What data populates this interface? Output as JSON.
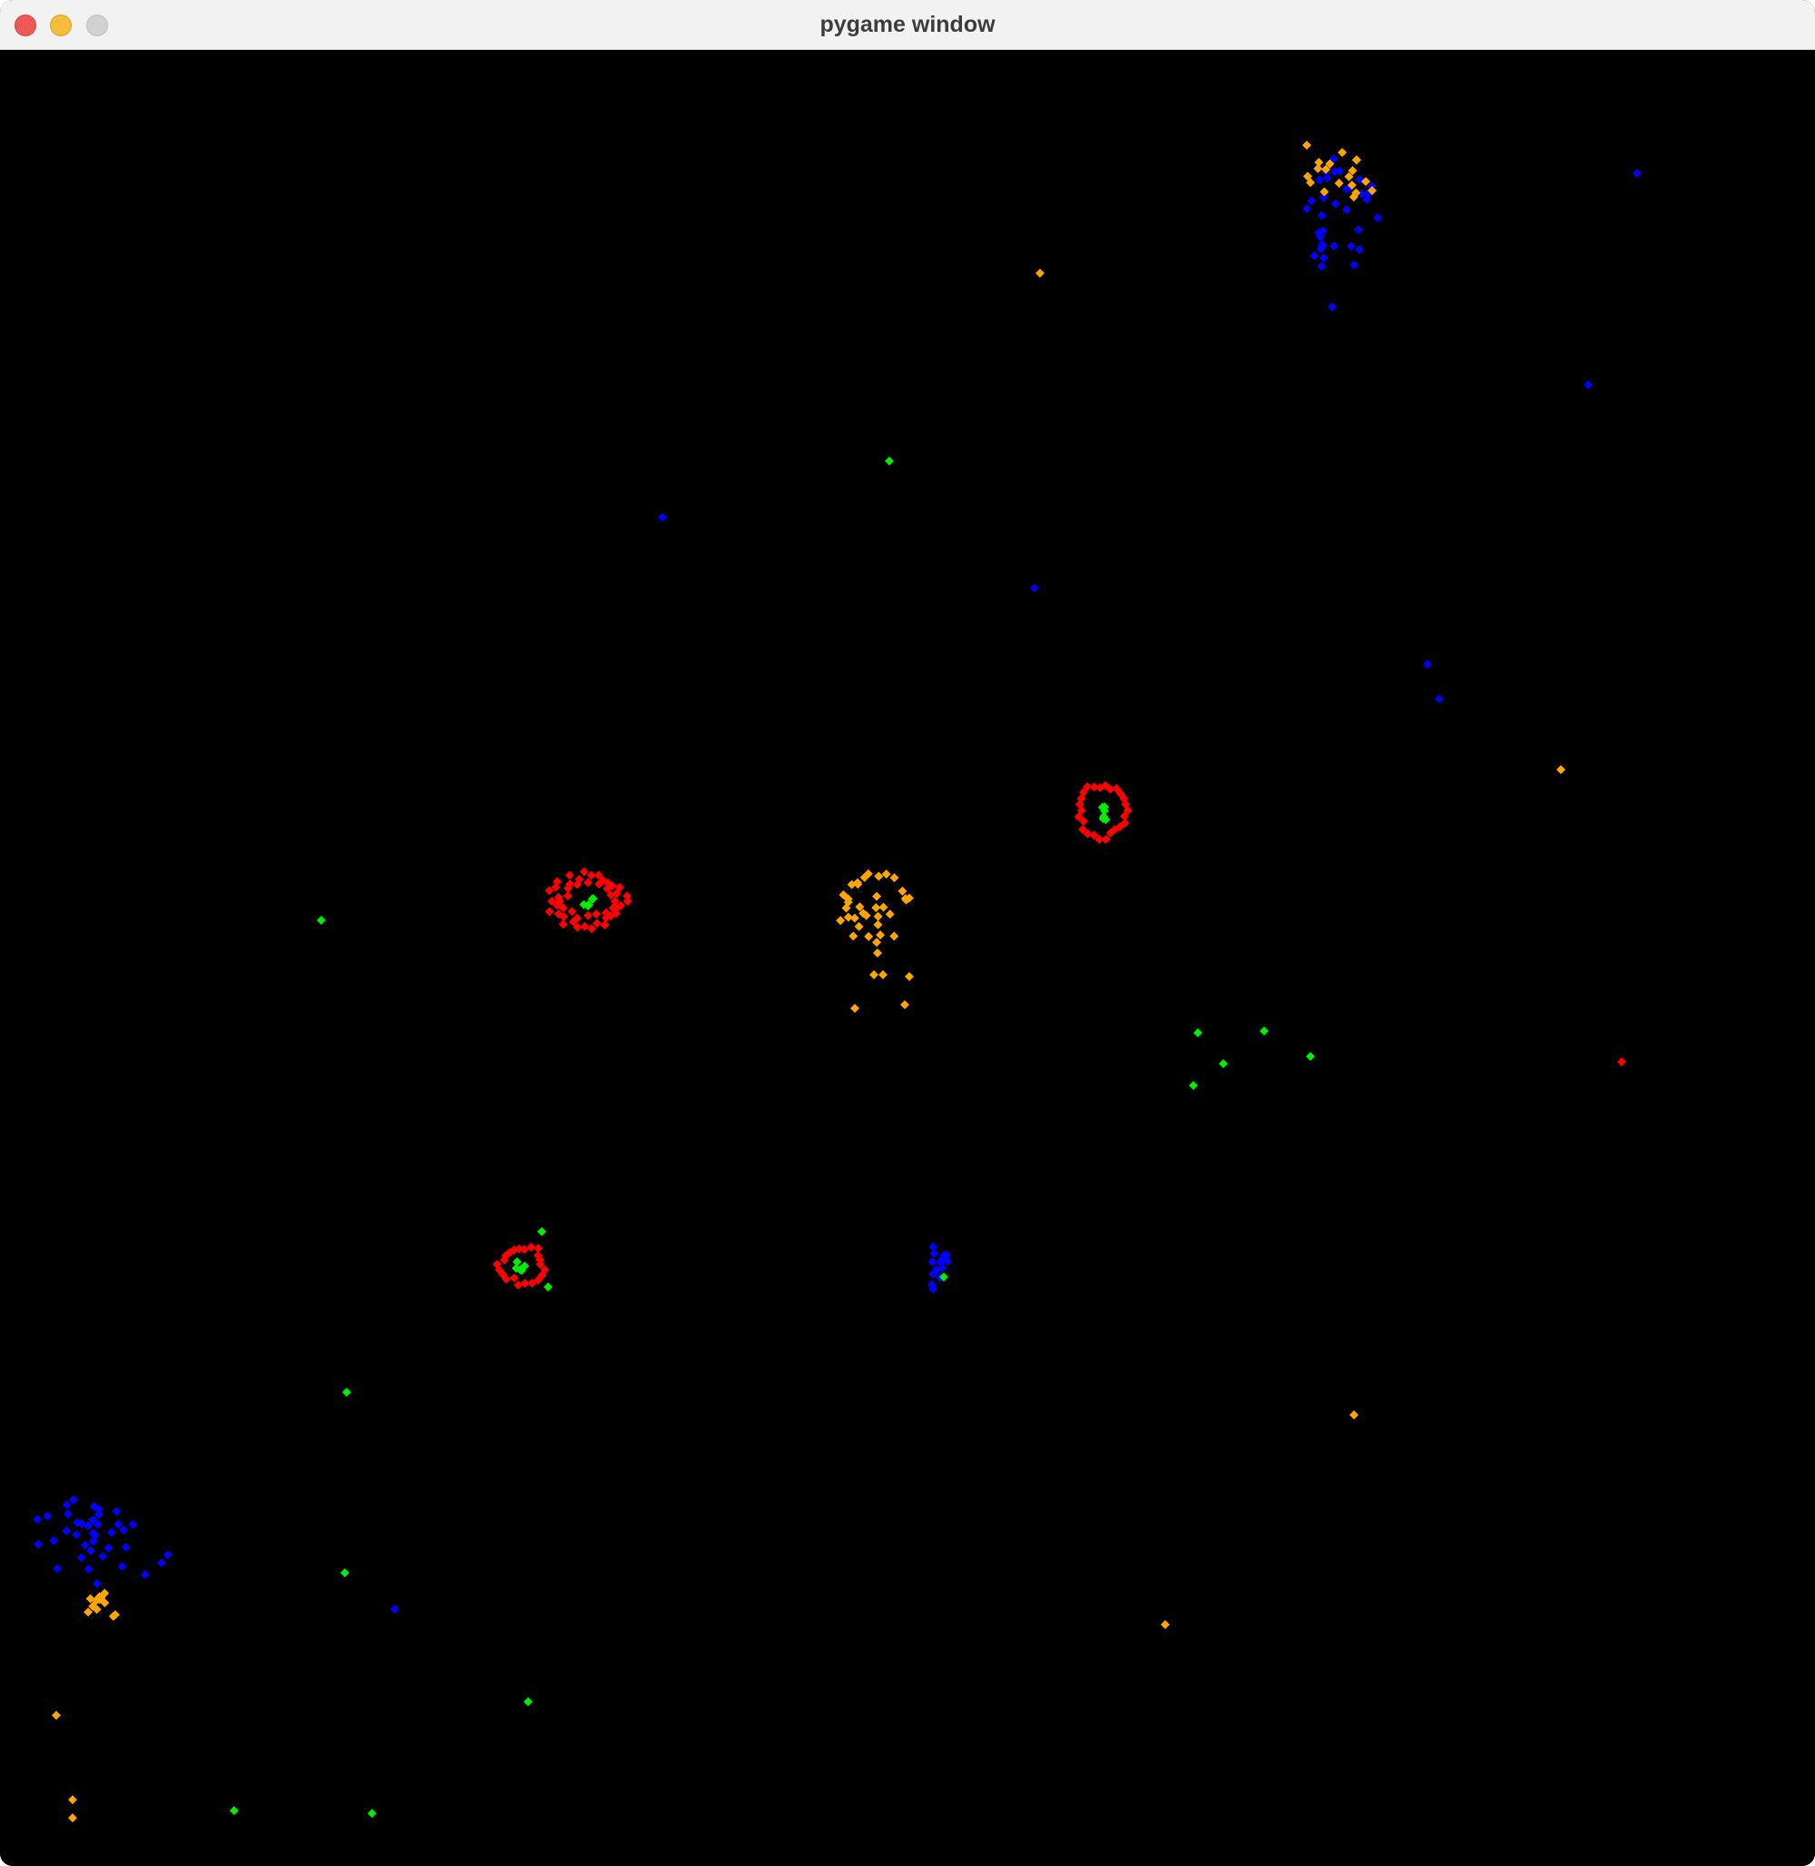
{
  "window": {
    "title": "pygame window"
  },
  "colors": {
    "background": "#000000",
    "red": "#ff0000",
    "green": "#00ee00",
    "blue": "#0000ff",
    "orange": "#ffa500"
  }
}
